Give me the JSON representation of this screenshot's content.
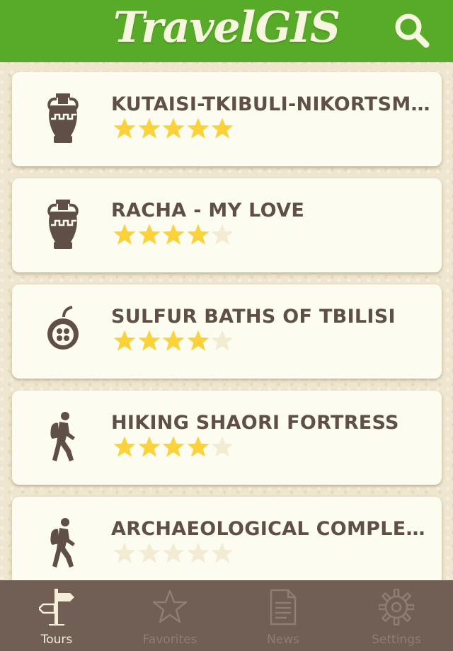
{
  "app": {
    "title": "TravelGIS"
  },
  "colors": {
    "header": "#58ab28",
    "tabbar": "#715f56",
    "star_on": "#fcd23a",
    "star_off": "#f4ecd2",
    "icon": "#5f4f47"
  },
  "header": {
    "search_icon": "search-icon"
  },
  "tours": [
    {
      "title": "KUTAISI-TKIBULI-NIKORTSMI...",
      "icon": "amphora-icon",
      "rating": 5,
      "max": 5
    },
    {
      "title": "RACHA - MY LOVE",
      "icon": "amphora-icon",
      "rating": 4,
      "max": 5
    },
    {
      "title": "SULFUR BATHS OF TBILISI",
      "icon": "pomegranate-icon",
      "rating": 4,
      "max": 5
    },
    {
      "title": "HIKING SHAORI FORTRESS",
      "icon": "hiker-icon",
      "rating": 4,
      "max": 5
    },
    {
      "title": "ARCHAEOLOGICAL COMPLEX...",
      "icon": "hiker-icon",
      "rating": 0,
      "max": 5
    }
  ],
  "tabs": [
    {
      "label": "Tours",
      "icon": "signpost-icon",
      "active": true
    },
    {
      "label": "Favorites",
      "icon": "star-icon",
      "active": false
    },
    {
      "label": "News",
      "icon": "document-icon",
      "active": false
    },
    {
      "label": "Settings",
      "icon": "gear-icon",
      "active": false
    }
  ]
}
